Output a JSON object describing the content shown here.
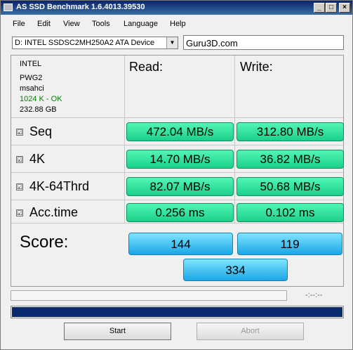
{
  "window": {
    "title": "AS SSD Benchmark 1.6.4013.39530"
  },
  "titlebar_buttons": {
    "minimize": "_",
    "maximize": "□",
    "close": "×"
  },
  "menu": [
    "File",
    "Edit",
    "View",
    "Tools",
    "Language",
    "Help"
  ],
  "drive": {
    "selected": "D: INTEL SSDSC2MH250A2 ATA Device",
    "arrow": "▼"
  },
  "name_field": {
    "value": "Guru3D.com"
  },
  "info": {
    "vendor": "INTEL",
    "firmware": "PWG2",
    "driver": "msahci",
    "alignment": "1024 K - OK",
    "capacity": "232.88 GB"
  },
  "headers": {
    "read": "Read:",
    "write": "Write:"
  },
  "rows": [
    {
      "label": "Seq",
      "checked": "☑",
      "read": "472.04 MB/s",
      "write": "312.80 MB/s"
    },
    {
      "label": "4K",
      "checked": "☑",
      "read": "14.70 MB/s",
      "write": "36.82 MB/s"
    },
    {
      "label": "4K-64Thrd",
      "checked": "☑",
      "read": "82.07 MB/s",
      "write": "50.68 MB/s"
    },
    {
      "label": "Acc.time",
      "checked": "☑",
      "read": "0.256 ms",
      "write": "0.102 ms"
    }
  ],
  "score": {
    "label": "Score:",
    "read": "144",
    "write": "119",
    "total": "334"
  },
  "status": {
    "time": "-:--:--"
  },
  "progress": {
    "fraction": 1.0
  },
  "buttons": {
    "start": "Start",
    "abort": "Abort"
  },
  "colors": {
    "title_bar": "#0a246a",
    "value_green": "#2ee3a0",
    "score_blue": "#29b6f0",
    "progress_fill": "#0a2a6e",
    "alignment_ok": "#008000"
  }
}
